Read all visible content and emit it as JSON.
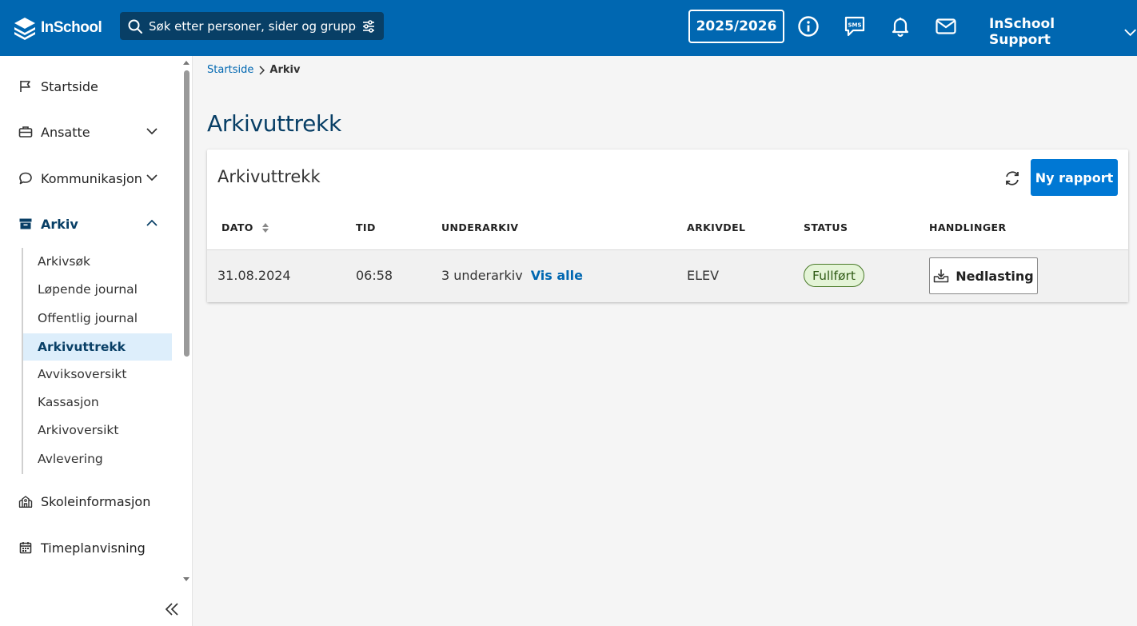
{
  "header": {
    "logo_text": "InSchool",
    "search_placeholder": "Søk etter personer, sider og grupper",
    "year_label": "2025/2026",
    "user_name": "InSchool Support",
    "icons": [
      "info-icon",
      "sms-icon",
      "bell-icon",
      "mail-icon"
    ]
  },
  "sidebar": {
    "items": [
      {
        "label": "Startside",
        "icon": "flag-icon"
      },
      {
        "label": "Ansatte",
        "icon": "briefcase-icon"
      },
      {
        "label": "Kommunikasjon",
        "icon": "chat-icon"
      },
      {
        "label": "Arkiv",
        "icon": "archive-box-icon"
      },
      {
        "label": "Skoleinformasjon",
        "icon": "school-icon"
      },
      {
        "label": "Timeplanvisning",
        "icon": "calendar-icon"
      }
    ],
    "subitems": [
      {
        "label": "Arkivsøk"
      },
      {
        "label": "Løpende journal"
      },
      {
        "label": "Offentlig journal"
      },
      {
        "label": "Arkivuttrekk"
      },
      {
        "label": "Avviksoversikt"
      },
      {
        "label": "Kassasjon"
      },
      {
        "label": "Arkivoversikt"
      },
      {
        "label": "Avlevering"
      }
    ]
  },
  "breadcrumb": {
    "home": "Startside",
    "current": "Arkiv"
  },
  "main": {
    "page_title": "Arkivuttrekk",
    "card_title": "Arkivuttrekk",
    "new_report_label": "Ny rapport",
    "table": {
      "headers": [
        "DATO",
        "TID",
        "UNDERARKIV",
        "ARKIVDEL",
        "STATUS",
        "HANDLINGER"
      ],
      "rows": [
        {
          "dato": "31.08.2024",
          "tid": "06:58",
          "underarkiv": "3 underarkiv",
          "vis_alle": "Vis alle",
          "arkivdel": "ELEV",
          "status": "Fullført",
          "action": "Nedlasting"
        }
      ]
    }
  },
  "colors": {
    "header_bg": "#0067b1",
    "search_bg": "#083f66",
    "primary_button": "#0078d4",
    "title_color": "#083f66",
    "active_nav_bg": "#ddeefb",
    "status_bg": "#e4f4d7",
    "status_border": "#4a7a2a"
  }
}
